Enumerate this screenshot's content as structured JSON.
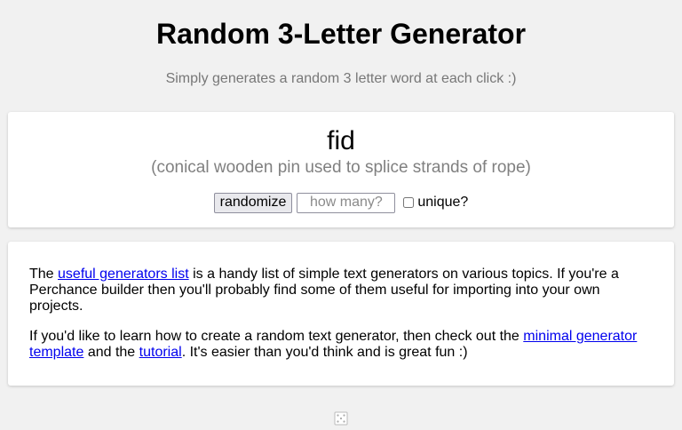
{
  "header": {
    "title": "Random 3-Letter Generator",
    "subtitle": "Simply generates a random 3 letter word at each click :)"
  },
  "output": {
    "word": "fid",
    "definition": "(conical wooden pin used to splice strands of rope)"
  },
  "controls": {
    "randomize_label": "randomize",
    "count_placeholder": "how many?",
    "count_value": "",
    "unique_label": "unique?",
    "unique_checked": false
  },
  "info": {
    "para1": {
      "prefix": "The ",
      "link1": "useful generators list",
      "suffix": " is a handy list of simple text generators on various topics. If you're a Perchance builder then you'll probably find some of them useful for importing into your own projects."
    },
    "para2": {
      "prefix": "If you'd like to learn how to create a random text generator, then check out the ",
      "link1": "minimal generator template",
      "middle": " and the ",
      "link2": "tutorial",
      "suffix": ". It's easier than you'd think and is great fun :)"
    }
  },
  "footer": {
    "icon": "dice-icon"
  },
  "colors": {
    "background": "#f1f1f1",
    "link": "#0000ee",
    "subtitle": "#777777",
    "definition": "#808080"
  }
}
